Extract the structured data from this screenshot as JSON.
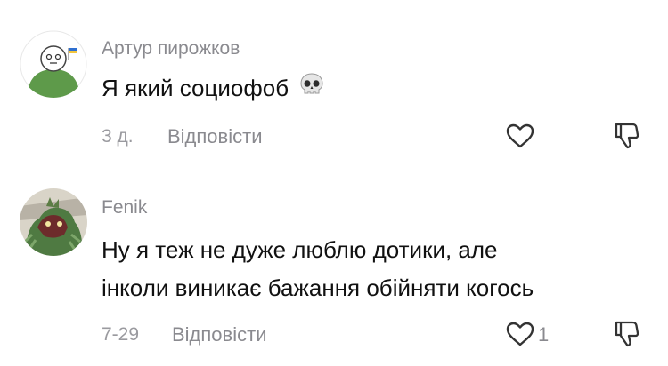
{
  "comments": [
    {
      "username": "Артур пирожков",
      "text": "Я який социофоб",
      "emoji_icon": "skull-emoji-icon",
      "date": "3 д.",
      "reply_label": "Відповісти",
      "like_count": ""
    },
    {
      "username": "Fenik",
      "text_lines": [
        "Ну я теж не дуже люблю дотики, але",
        "інколи виникає бажання обійняти когось"
      ],
      "date": "7-29",
      "reply_label": "Відповісти",
      "like_count": "1"
    }
  ],
  "icons": [
    "heart-outline-icon",
    "thumb-down-icon"
  ],
  "colors": {
    "text": "#111111",
    "muted": "#8a8a8f",
    "avatar_green": "#5e9a4a"
  }
}
